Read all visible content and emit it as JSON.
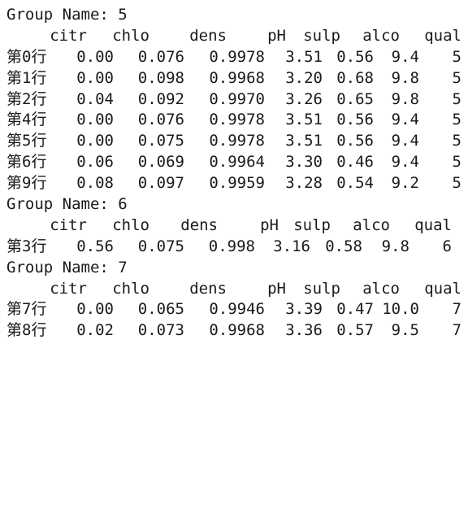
{
  "output": {
    "groups": [
      {
        "title": "Group Name: 5",
        "columns": [
          "citr",
          "chlo",
          "dens",
          "pH",
          "sulp",
          "alco",
          "qual"
        ],
        "rows": [
          {
            "index": "第0行",
            "values": [
              "0.00",
              "0.076",
              "0.9978",
              "3.51",
              "0.56",
              "9.4",
              "5"
            ]
          },
          {
            "index": "第1行",
            "values": [
              "0.00",
              "0.098",
              "0.9968",
              "3.20",
              "0.68",
              "9.8",
              "5"
            ]
          },
          {
            "index": "第2行",
            "values": [
              "0.04",
              "0.092",
              "0.9970",
              "3.26",
              "0.65",
              "9.8",
              "5"
            ]
          },
          {
            "index": "第4行",
            "values": [
              "0.00",
              "0.076",
              "0.9978",
              "3.51",
              "0.56",
              "9.4",
              "5"
            ]
          },
          {
            "index": "第5行",
            "values": [
              "0.00",
              "0.075",
              "0.9978",
              "3.51",
              "0.56",
              "9.4",
              "5"
            ]
          },
          {
            "index": "第6行",
            "values": [
              "0.06",
              "0.069",
              "0.9964",
              "3.30",
              "0.46",
              "9.4",
              "5"
            ]
          },
          {
            "index": "第9行",
            "values": [
              "0.08",
              "0.097",
              "0.9959",
              "3.28",
              "0.54",
              "9.2",
              "5"
            ]
          }
        ]
      },
      {
        "title": "Group Name: 6",
        "columns": [
          "citr",
          "chlo",
          "dens",
          "pH",
          "sulp",
          "alco",
          "qual"
        ],
        "rows": [
          {
            "index": "第3行",
            "values": [
              "0.56",
              "0.075",
              "0.998",
              "3.16",
              "0.58",
              "9.8",
              "6"
            ]
          }
        ]
      },
      {
        "title": "Group Name: 7",
        "columns": [
          "citr",
          "chlo",
          "dens",
          "pH",
          "sulp",
          "alco",
          "qual"
        ],
        "rows": [
          {
            "index": "第7行",
            "values": [
              "0.00",
              "0.065",
              "0.9946",
              "3.39",
              "0.47",
              "10.0",
              "7"
            ]
          },
          {
            "index": "第8行",
            "values": [
              "0.02",
              "0.073",
              "0.9968",
              "3.36",
              "0.57",
              "9.5",
              "7"
            ]
          }
        ]
      }
    ]
  }
}
